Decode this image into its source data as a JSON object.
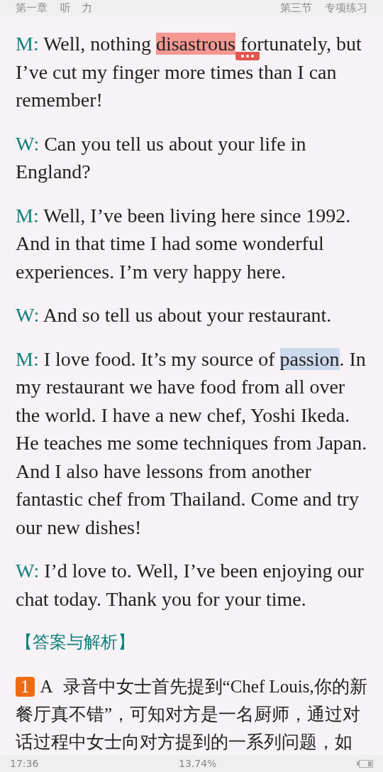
{
  "header": {
    "chapter": "第一章",
    "chapter_title": "听　力",
    "section": "第三节",
    "section_title": "专项练习"
  },
  "dialogue": [
    {
      "speaker": "M:",
      "parts": [
        {
          "text": "Well, nothing ",
          "kind": "plain"
        },
        {
          "text": "disastrous",
          "kind": "note"
        },
        {
          "text": " fortunately, but I’ve cut my finger more times than I can remember!",
          "kind": "plain"
        }
      ]
    },
    {
      "speaker": "W:",
      "parts": [
        {
          "text": "Can you tell us about your life in England?",
          "kind": "plain"
        }
      ]
    },
    {
      "speaker": "M:",
      "parts": [
        {
          "text": "Well, I’ve been living here since 1992. And in that time I had some wonderful experiences. I’m very happy here.",
          "kind": "plain"
        }
      ]
    },
    {
      "speaker": "W:",
      "parts": [
        {
          "text": "And so tell us about your restaurant.",
          "kind": "plain"
        }
      ]
    },
    {
      "speaker": "M:",
      "parts": [
        {
          "text": "I love food. It’s my source of ",
          "kind": "plain"
        },
        {
          "text": "passion",
          "kind": "selection"
        },
        {
          "text": ". In my restaurant we have food from all over the world. I have a new chef, Yoshi Ikeda. He teaches me some techniques from Japan. And I also have lessons from another fantastic chef from Thailand. Come and try our new dishes!",
          "kind": "plain"
        }
      ]
    },
    {
      "speaker": "W:",
      "parts": [
        {
          "text": "I’d love to. Well, I’ve been enjoying our chat today. Thank you for your time.",
          "kind": "plain"
        }
      ]
    }
  ],
  "answers_heading": "【答案与解析】",
  "answers": [
    {
      "number": "1",
      "answer": "A",
      "text": "录音中女士首先提到“Chef Louis,你的新餐厅真不错”，可知对方是一名厨师，通过对话过程中女士向对方提到的一系列问题，如"
    }
  ],
  "footer": {
    "time": "17:36",
    "progress": "13.74%"
  }
}
